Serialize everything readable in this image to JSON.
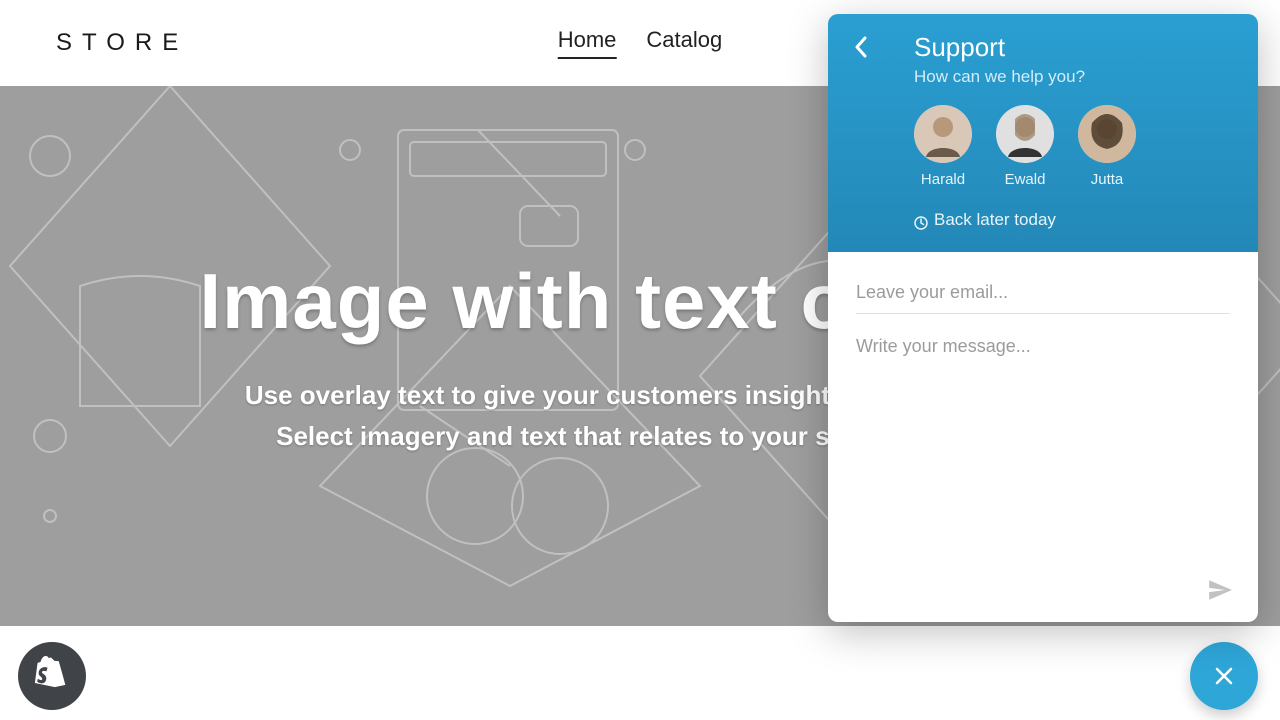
{
  "brand": "STORE",
  "nav": {
    "items": [
      {
        "label": "Home",
        "active": true
      },
      {
        "label": "Catalog",
        "active": false
      }
    ]
  },
  "hero": {
    "title": "Image with text overlay",
    "subtitle_line1": "Use overlay text to give your customers insight into your brand.",
    "subtitle_line2": "Select imagery and text that relates to your style and story."
  },
  "chat": {
    "title": "Support",
    "subtitle": "How can we help you?",
    "agents": [
      {
        "name": "Harald"
      },
      {
        "name": "Ewald"
      },
      {
        "name": "Jutta"
      }
    ],
    "status": "Back later today",
    "email_placeholder": "Leave your email...",
    "message_placeholder": "Write your message...",
    "accent_color": "#2ea6d8"
  }
}
